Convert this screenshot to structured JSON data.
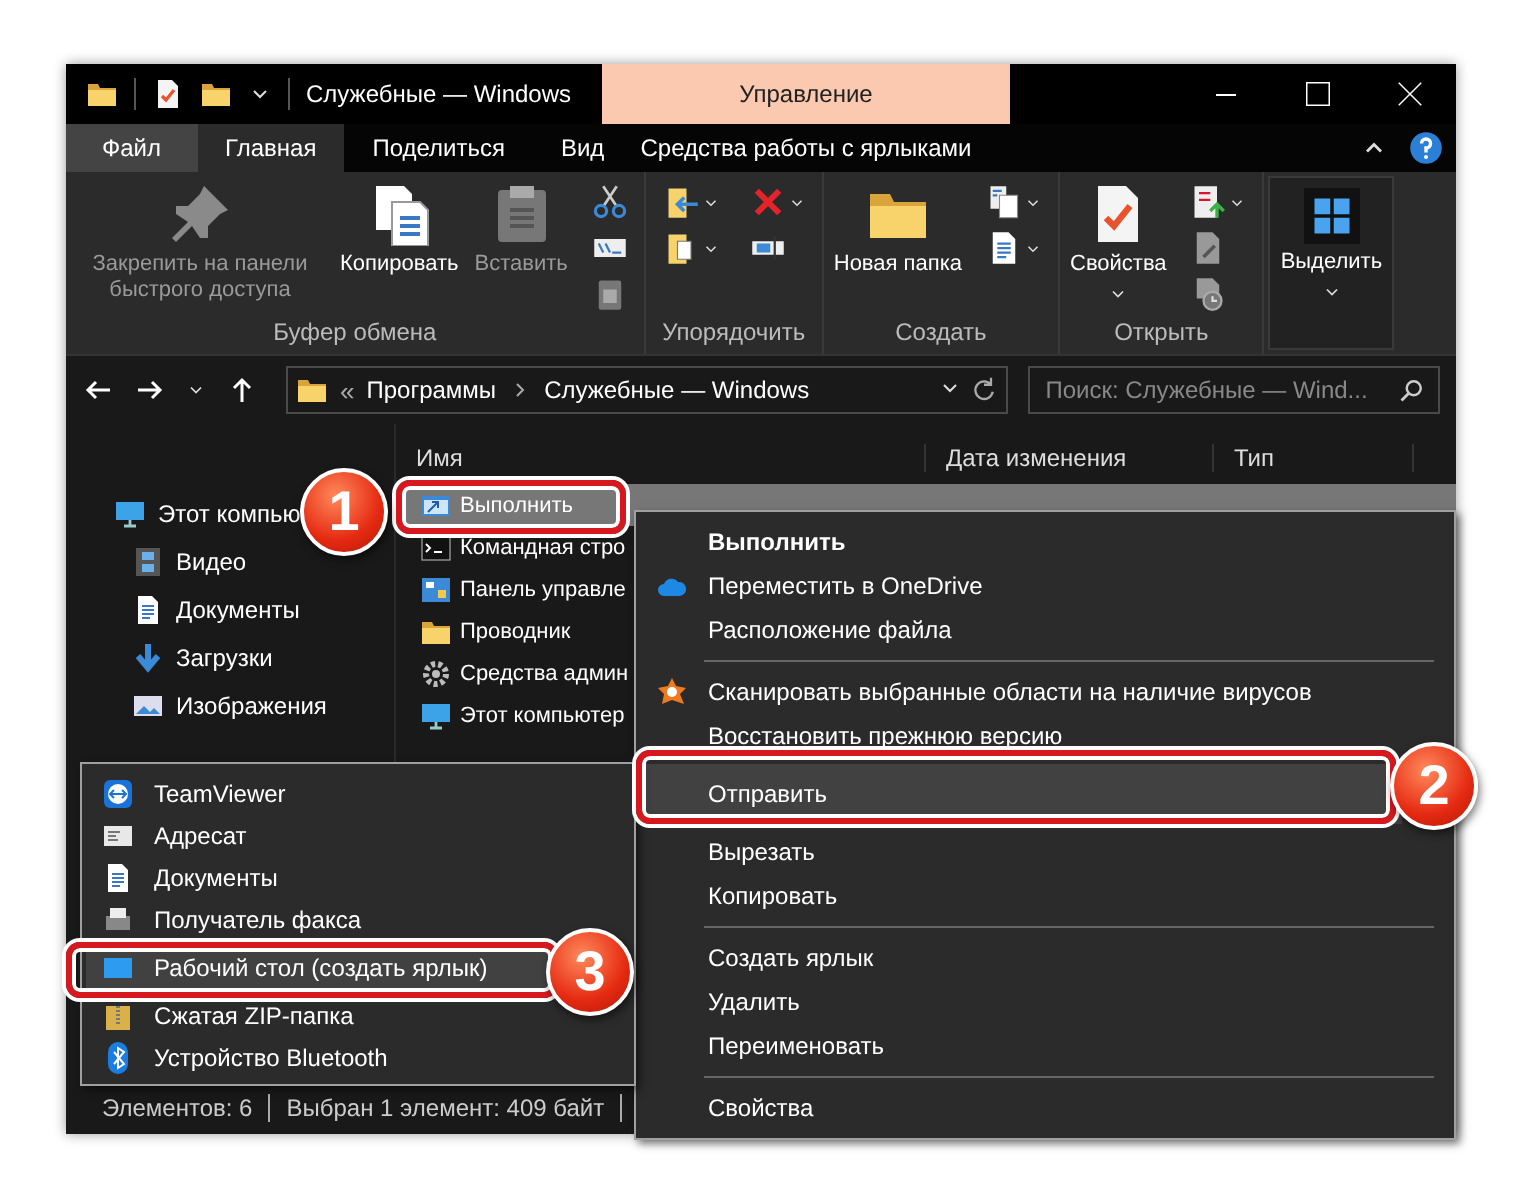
{
  "window": {
    "title": "Служебные — Windows",
    "context_group": "Управление"
  },
  "tabs": [
    {
      "label": "Файл",
      "kind": "file",
      "selected": false
    },
    {
      "label": "Главная",
      "kind": "plain",
      "selected": true
    },
    {
      "label": "Поделиться",
      "kind": "plain",
      "selected": false
    },
    {
      "label": "Вид",
      "kind": "plain",
      "selected": false
    },
    {
      "label": "Средства работы с ярлыками",
      "kind": "contextual",
      "selected": false
    }
  ],
  "ribbon": [
    {
      "label": "Буфер обмена",
      "large": [
        {
          "kind": "pin",
          "label": "Закрепить на панели быстрого доступа",
          "disabled": true,
          "dropdown": false
        },
        {
          "kind": "copy",
          "label": "Копировать",
          "disabled": false,
          "dropdown": false
        },
        {
          "kind": "paste",
          "label": "Вставить",
          "disabled": true,
          "dropdown": false
        }
      ],
      "small_columns": [
        {
          "tools": [
            {
              "kind": "cut",
              "dropdown": false
            },
            {
              "kind": "copy-path",
              "dropdown": false
            },
            {
              "kind": "paste-shortcut",
              "dropdown": false
            }
          ]
        }
      ]
    },
    {
      "label": "Упорядочить",
      "small_columns": [
        {
          "tools": [
            {
              "kind": "move-to",
              "dropdown": true
            },
            {
              "kind": "copy-to",
              "dropdown": true
            }
          ]
        },
        {
          "tools": [
            {
              "kind": "delete",
              "dropdown": true
            },
            {
              "kind": "rename",
              "dropdown": false
            }
          ]
        }
      ]
    },
    {
      "label": "Создать",
      "large": [
        {
          "kind": "new-folder",
          "label": "Новая папка",
          "disabled": false,
          "dropdown": false
        }
      ],
      "small_columns": [
        {
          "tools": [
            {
              "kind": "new-item",
              "dropdown": true
            },
            {
              "kind": "easy-access",
              "dropdown": true
            }
          ]
        }
      ]
    },
    {
      "label": "Открыть",
      "large": [
        {
          "kind": "properties",
          "label": "Свойства",
          "disabled": false,
          "dropdown": true
        }
      ],
      "small_columns": [
        {
          "tools": [
            {
              "kind": "open",
              "dropdown": true
            },
            {
              "kind": "edit",
              "dropdown": false
            },
            {
              "kind": "history",
              "dropdown": false
            }
          ]
        }
      ]
    },
    {
      "large": [
        {
          "kind": "select",
          "label": "Выделить",
          "disabled": false,
          "dropdown": true
        }
      ]
    }
  ],
  "nav": {
    "address": {
      "prefix": "«",
      "crumbs": [
        "Программы",
        "Служебные — Windows"
      ]
    },
    "search": {
      "placeholder": "Поиск: Служебные — Wind..."
    }
  },
  "sidebar": {
    "items": [
      {
        "label": "Этот компью",
        "kind": "pc",
        "children": [
          {
            "label": "Видео",
            "kind": "video"
          },
          {
            "label": "Документы",
            "kind": "docs"
          },
          {
            "label": "Загрузки",
            "kind": "download"
          },
          {
            "label": "Изображения",
            "kind": "images"
          }
        ]
      }
    ]
  },
  "list": {
    "columns": [
      "Имя",
      "Дата изменения",
      "Тип"
    ],
    "rows": [
      {
        "name": "Выполнить",
        "kind": "run",
        "selected": true
      },
      {
        "name": "Командная стро",
        "kind": "cmd",
        "selected": false
      },
      {
        "name": "Панель управле",
        "kind": "control-panel",
        "selected": false
      },
      {
        "name": "Проводник",
        "kind": "folder",
        "selected": false
      },
      {
        "name": "Средства админ",
        "kind": "admin",
        "selected": false
      },
      {
        "name": "Этот компьютер",
        "kind": "pc",
        "selected": false
      }
    ]
  },
  "status": [
    "Элементов: 6",
    "Выбран 1 элемент: 409 байт"
  ],
  "context_menu": {
    "items": [
      {
        "kind": "plain",
        "label": "Выполнить",
        "bold": true,
        "selected": false
      },
      {
        "kind": "onedrive",
        "label": "Переместить в OneDrive",
        "bold": false,
        "selected": false
      },
      {
        "kind": "plain",
        "label": "Расположение файла",
        "bold": false,
        "selected": false
      },
      {
        "kind": "separator"
      },
      {
        "kind": "antivirus",
        "label": "Сканировать выбранные области на наличие вирусов",
        "bold": false,
        "selected": false
      },
      {
        "kind": "plain",
        "label": "Восстановить прежнюю версию",
        "bold": false,
        "selected": false
      },
      {
        "kind": "plain",
        "label": "Отправить",
        "bold": false,
        "selected": true
      },
      {
        "kind": "plain",
        "label": "Вырезать",
        "bold": false,
        "selected": false
      },
      {
        "kind": "plain",
        "label": "Копировать",
        "bold": false,
        "selected": false
      },
      {
        "kind": "separator"
      },
      {
        "kind": "plain",
        "label": "Создать ярлык",
        "bold": false,
        "selected": false
      },
      {
        "kind": "plain",
        "label": "Удалить",
        "bold": false,
        "selected": false
      },
      {
        "kind": "plain",
        "label": "Переименовать",
        "bold": false,
        "selected": false
      },
      {
        "kind": "separator"
      },
      {
        "kind": "plain",
        "label": "Свойства",
        "bold": false,
        "selected": false
      }
    ]
  },
  "send_to": {
    "items": [
      {
        "label": "TeamViewer",
        "kind": "teamviewer",
        "selected": false
      },
      {
        "label": "Адресат",
        "kind": "mail",
        "selected": false
      },
      {
        "label": "Документы",
        "kind": "docs",
        "selected": false
      },
      {
        "label": "Получатель факса",
        "kind": "fax",
        "selected": false
      },
      {
        "label": "Рабочий стол (создать ярлык)",
        "kind": "desktop",
        "selected": true
      },
      {
        "label": "Сжатая ZIP-папка",
        "kind": "zip",
        "selected": false
      },
      {
        "label": "Устройство Bluetooth",
        "kind": "bluetooth",
        "selected": false
      }
    ]
  },
  "callouts": [
    {
      "number": "1"
    },
    {
      "number": "2"
    },
    {
      "number": "3"
    }
  ]
}
